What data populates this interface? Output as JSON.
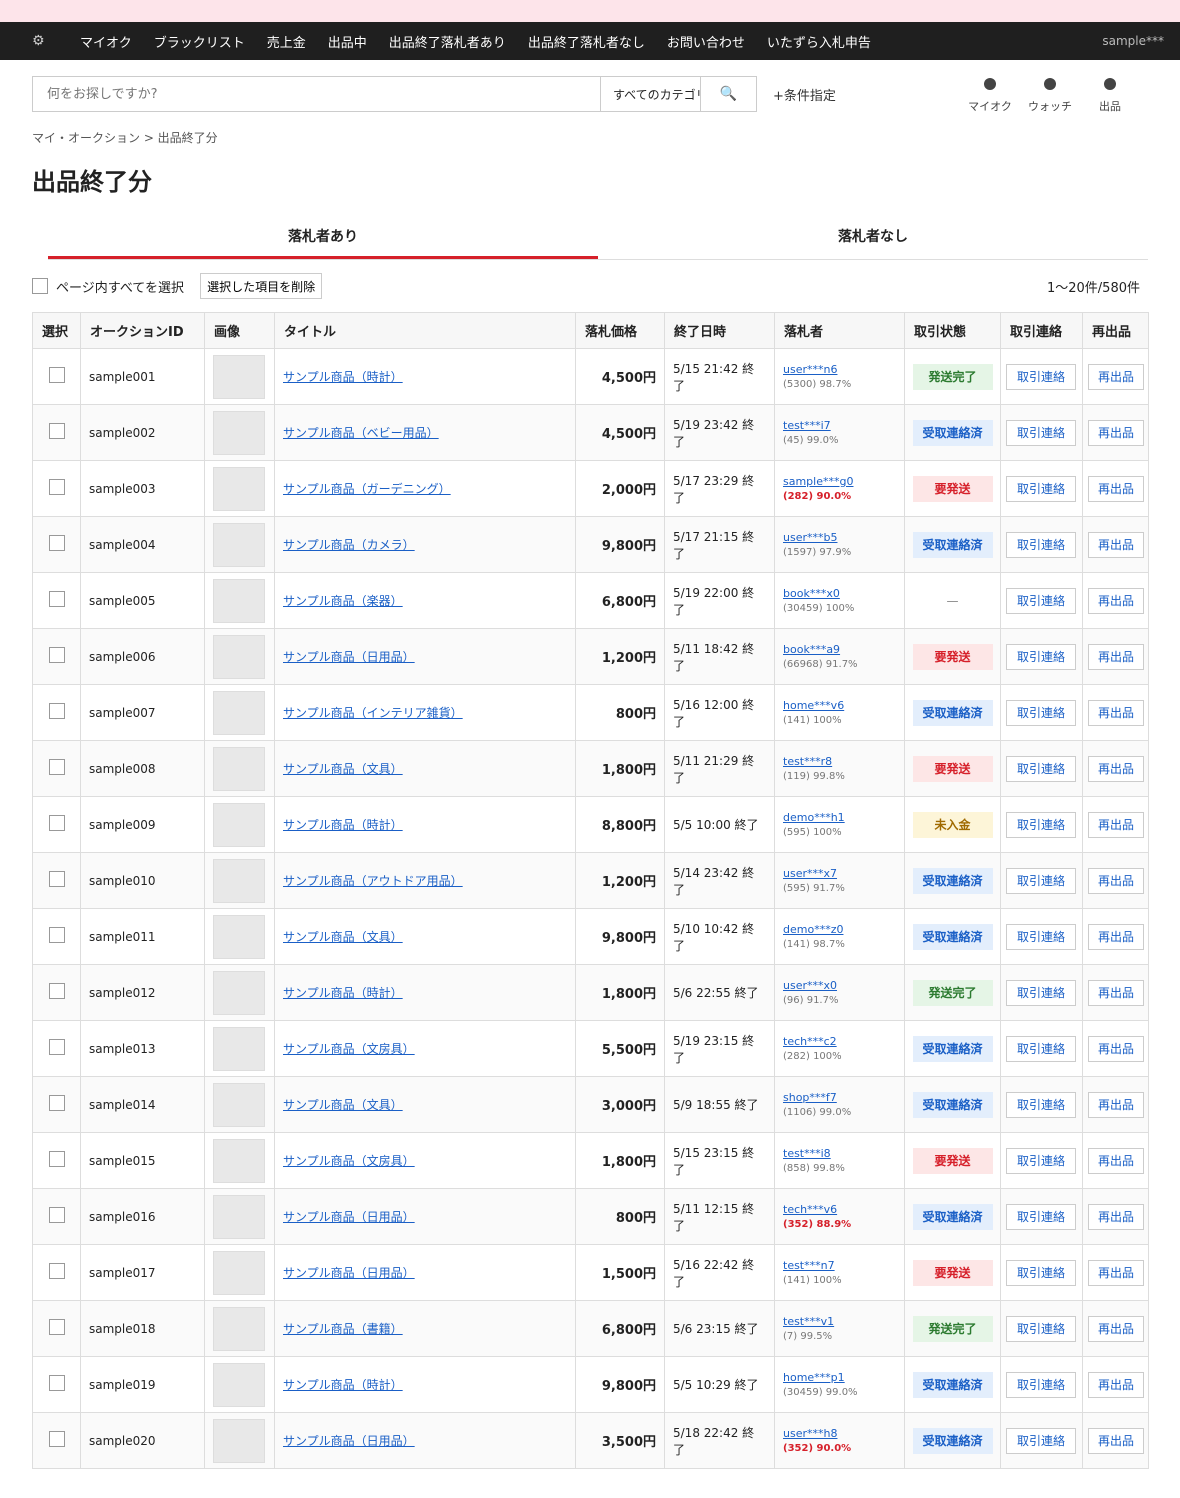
{
  "nav": {
    "gear_icon": "⚙",
    "items": [
      "マイオク",
      "ブラックリスト",
      "売上金",
      "出品中",
      "出品終了落札者あり",
      "出品終了落札者なし",
      "お問い合わせ",
      "いたずら入札申告"
    ],
    "user": "sample***"
  },
  "search": {
    "placeholder": "何をお探しですか?",
    "category": "すべてのカテゴリ",
    "search_icon": "🔍",
    "condition_link": "+条件指定"
  },
  "quick_links": [
    "マイオク",
    "ウォッチ",
    "出品"
  ],
  "breadcrumb": "マイ・オークション > 出品終了分",
  "page_title": "出品終了分",
  "tabs": [
    "落札者あり",
    "落札者なし"
  ],
  "controls": {
    "select_all": "ページ内すべてを選択",
    "delete_selected": "選択した項目を削除",
    "count": "1〜20件/580件"
  },
  "table": {
    "headers": [
      "選択",
      "オークションID",
      "画像",
      "タイトル",
      "落札価格",
      "終了日時",
      "落札者",
      "取引状態",
      "取引連絡",
      "再出品"
    ],
    "contact_label": "取引連絡",
    "relist_label": "再出品",
    "rows": [
      {
        "id": "sample001",
        "title": "サンプル商品（時計）",
        "price": "4,500円",
        "end": "5/15 21:42 終了",
        "bidder": "user***n6",
        "rating": "(5300) 98.7%",
        "rating_warn": false,
        "status": "発送完了",
        "status_type": "green"
      },
      {
        "id": "sample002",
        "title": "サンプル商品（ベビー用品）",
        "price": "4,500円",
        "end": "5/19 23:42 終了",
        "bidder": "test***i7",
        "rating": "(45) 99.0%",
        "rating_warn": false,
        "status": "受取連絡済",
        "status_type": "blue"
      },
      {
        "id": "sample003",
        "title": "サンプル商品（ガーデニング）",
        "price": "2,000円",
        "end": "5/17 23:29 終了",
        "bidder": "sample***g0",
        "rating": "(282) 90.0%",
        "rating_warn": true,
        "status": "要発送",
        "status_type": "red"
      },
      {
        "id": "sample004",
        "title": "サンプル商品（カメラ）",
        "price": "9,800円",
        "end": "5/17 21:15 終了",
        "bidder": "user***b5",
        "rating": "(1597) 97.9%",
        "rating_warn": false,
        "status": "受取連絡済",
        "status_type": "blue"
      },
      {
        "id": "sample005",
        "title": "サンプル商品（楽器）",
        "price": "6,800円",
        "end": "5/19 22:00 終了",
        "bidder": "book***x0",
        "rating": "(30459) 100%",
        "rating_warn": false,
        "status": "—",
        "status_type": "none"
      },
      {
        "id": "sample006",
        "title": "サンプル商品（日用品）",
        "price": "1,200円",
        "end": "5/11 18:42 終了",
        "bidder": "book***a9",
        "rating": "(66968) 91.7%",
        "rating_warn": false,
        "status": "要発送",
        "status_type": "red"
      },
      {
        "id": "sample007",
        "title": "サンプル商品（インテリア雑貨）",
        "price": "800円",
        "end": "5/16 12:00 終了",
        "bidder": "home***v6",
        "rating": "(141) 100%",
        "rating_warn": false,
        "status": "受取連絡済",
        "status_type": "blue"
      },
      {
        "id": "sample008",
        "title": "サンプル商品（文具）",
        "price": "1,800円",
        "end": "5/11 21:29 終了",
        "bidder": "test***r8",
        "rating": "(119) 99.8%",
        "rating_warn": false,
        "status": "要発送",
        "status_type": "red"
      },
      {
        "id": "sample009",
        "title": "サンプル商品（時計）",
        "price": "8,800円",
        "end": "5/5 10:00 終了",
        "bidder": "demo***h1",
        "rating": "(595) 100%",
        "rating_warn": false,
        "status": "未入金",
        "status_type": "yellow"
      },
      {
        "id": "sample010",
        "title": "サンプル商品（アウトドア用品）",
        "price": "1,200円",
        "end": "5/14 23:42 終了",
        "bidder": "user***x7",
        "rating": "(595) 91.7%",
        "rating_warn": false,
        "status": "受取連絡済",
        "status_type": "blue"
      },
      {
        "id": "sample011",
        "title": "サンプル商品（文具）",
        "price": "9,800円",
        "end": "5/10 10:42 終了",
        "bidder": "demo***z0",
        "rating": "(141) 98.7%",
        "rating_warn": false,
        "status": "受取連絡済",
        "status_type": "blue"
      },
      {
        "id": "sample012",
        "title": "サンプル商品（時計）",
        "price": "1,800円",
        "end": "5/6 22:55 終了",
        "bidder": "user***x0",
        "rating": "(96) 91.7%",
        "rating_warn": false,
        "status": "発送完了",
        "status_type": "green"
      },
      {
        "id": "sample013",
        "title": "サンプル商品（文房具）",
        "price": "5,500円",
        "end": "5/19 23:15 終了",
        "bidder": "tech***c2",
        "rating": "(282) 100%",
        "rating_warn": false,
        "status": "受取連絡済",
        "status_type": "blue"
      },
      {
        "id": "sample014",
        "title": "サンプル商品（文具）",
        "price": "3,000円",
        "end": "5/9 18:55 終了",
        "bidder": "shop***f7",
        "rating": "(1106) 99.0%",
        "rating_warn": false,
        "status": "受取連絡済",
        "status_type": "blue"
      },
      {
        "id": "sample015",
        "title": "サンプル商品（文房具）",
        "price": "1,800円",
        "end": "5/15 23:15 終了",
        "bidder": "test***i8",
        "rating": "(858) 99.8%",
        "rating_warn": false,
        "status": "要発送",
        "status_type": "red"
      },
      {
        "id": "sample016",
        "title": "サンプル商品（日用品）",
        "price": "800円",
        "end": "5/11 12:15 終了",
        "bidder": "tech***v6",
        "rating": "(352) 88.9%",
        "rating_warn": true,
        "status": "受取連絡済",
        "status_type": "blue"
      },
      {
        "id": "sample017",
        "title": "サンプル商品（日用品）",
        "price": "1,500円",
        "end": "5/16 22:42 終了",
        "bidder": "test***n7",
        "rating": "(141) 100%",
        "rating_warn": false,
        "status": "要発送",
        "status_type": "red"
      },
      {
        "id": "sample018",
        "title": "サンプル商品（書籍）",
        "price": "6,800円",
        "end": "5/6 23:15 終了",
        "bidder": "test***v1",
        "rating": "(7) 99.5%",
        "rating_warn": false,
        "status": "発送完了",
        "status_type": "green"
      },
      {
        "id": "sample019",
        "title": "サンプル商品（時計）",
        "price": "9,800円",
        "end": "5/5 10:29 終了",
        "bidder": "home***p1",
        "rating": "(30459) 99.0%",
        "rating_warn": false,
        "status": "受取連絡済",
        "status_type": "blue"
      },
      {
        "id": "sample020",
        "title": "サンプル商品（日用品）",
        "price": "3,500円",
        "end": "5/18 22:42 終了",
        "bidder": "user***h8",
        "rating": "(352) 90.0%",
        "rating_warn": true,
        "status": "受取連絡済",
        "status_type": "blue"
      }
    ]
  },
  "colors": {
    "top_strip": "#fde4ea",
    "navbar": "#1f1f1f",
    "accent_red": "#d6202a",
    "link_blue": "#1a5fc6"
  }
}
